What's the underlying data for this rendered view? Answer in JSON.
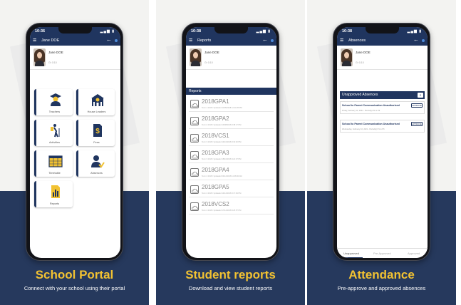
{
  "colors": {
    "navy": "#26395d",
    "appbar": "#20355f",
    "accent_yellow": "#f2c232",
    "panel_bg": "#f3f3f1"
  },
  "panels": [
    {
      "caption": "School Portal",
      "subcaption": "Connect with your school using their portal",
      "phone": {
        "time": "10:36",
        "title": "Jane DOE",
        "profile": {
          "name": "Jane DOE",
          "grade": "Gr 1/10"
        },
        "tiles": [
          {
            "label": "Teachers",
            "icon": "teacher-icon"
          },
          {
            "label": "House Leaders",
            "icon": "building-icon"
          },
          {
            "label": "Activities",
            "icon": "hiker-icon"
          },
          {
            "label": "Fees",
            "icon": "fee-document-icon"
          },
          {
            "label": "Timetable",
            "icon": "calendar-icon"
          },
          {
            "label": "Absences",
            "icon": "person-check-icon"
          },
          {
            "label": "Reports",
            "icon": "bar-chart-icon"
          }
        ]
      }
    },
    {
      "caption": "Student reports",
      "subcaption": "Download and view student reports",
      "phone": {
        "time": "10:38",
        "title": "Reports",
        "profile": {
          "name": "Jane DOE",
          "grade": "Gr 1/10"
        },
        "section": "Reports",
        "reports": [
          {
            "code": "2018GPA1",
            "meta": "Term 1 2018 / Uploaded 11/05/2018 12:44:35 PM"
          },
          {
            "code": "2018GPA2",
            "meta": "Term 2 2018 / Uploaded 13/08/2018 3:38:17 PM"
          },
          {
            "code": "2018VCS1",
            "meta": "Term 3 2018 / Uploaded 14/10/2018 3:32:40 PM"
          },
          {
            "code": "2018GPA3",
            "meta": "Term 3 2018 / Uploaded 18/10/2018 4:21:37 PM"
          },
          {
            "code": "2018GPA4",
            "meta": "Term 4 2018 / Uploaded 04/12/2018 11:38:30 AM"
          },
          {
            "code": "2018GPA5",
            "meta": "Term 4 2018 / Uploaded 14/12/2018 3:17:49 PM"
          },
          {
            "code": "2018VCS2",
            "meta": "Term 4 2018 / Uploaded 17/12/2018 9:25:57 PM"
          }
        ]
      }
    },
    {
      "caption": "Attendance",
      "subcaption": "Pre-approve and approved absences",
      "phone": {
        "time": "10:38",
        "title": "Absences",
        "profile": {
          "name": "Jane DOE",
          "grade": "Gr 1/10"
        },
        "section": "Unapproved Absences",
        "count": "2",
        "items": [
          {
            "title": "School to Parent Communication Unauthorised",
            "date": "Friday, February 12, 2021 - Period(s) P1 to P6",
            "button": "APPROVE"
          },
          {
            "title": "School to Parent Communication Unauthorised",
            "date": "Wednesday, February 10, 2021 - Period(s) P1 to P6",
            "button": "APPROVE"
          }
        ],
        "tabs": [
          "Unapproved",
          "Pre-Approved",
          "Approved"
        ]
      }
    }
  ]
}
